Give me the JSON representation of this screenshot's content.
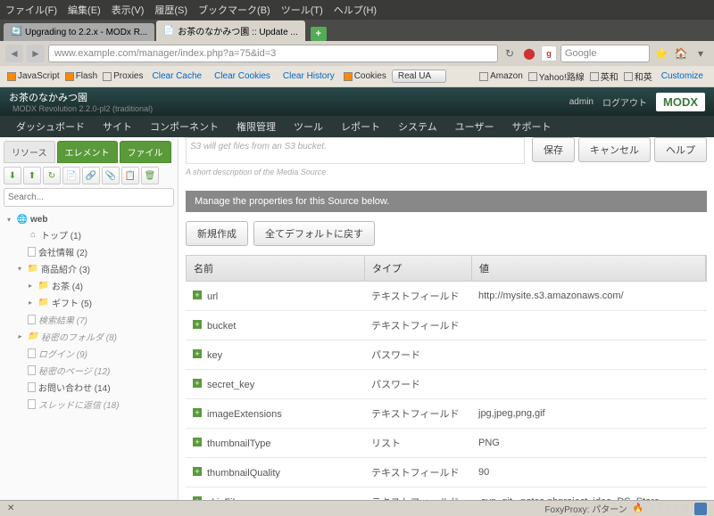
{
  "browser": {
    "menus": [
      "ファイル(F)",
      "編集(E)",
      "表示(V)",
      "履歴(S)",
      "ブックマーク(B)",
      "ツール(T)",
      "ヘルプ(H)"
    ],
    "tabs": [
      {
        "title": "Upgrading to 2.2.x - MODx R...",
        "active": false
      },
      {
        "title": "お茶のなかみつ園 :: Update ...",
        "active": true
      }
    ],
    "url": "www.example.com/manager/index.php?a=75&id=3",
    "search_placeholder": "Google"
  },
  "devbar": {
    "items": [
      "JavaScript",
      "Flash",
      "Proxies"
    ],
    "links": [
      "Clear Cache",
      "Clear Cookies",
      "Clear History"
    ],
    "cookies": "Cookies",
    "ua": "Real UA",
    "right_items": [
      "Amazon",
      "Yahoo!路線",
      "英和",
      "和英"
    ],
    "customize": "Customize"
  },
  "modx": {
    "site_title": "お茶のなかみつ園",
    "version": "MODX Revolution 2.2.0-pl2 (traditional)",
    "admin": "admin",
    "logout": "ログアウト",
    "logo": "MODX",
    "nav": [
      "ダッシュボード",
      "サイト",
      "コンポーネント",
      "権限管理",
      "ツール",
      "レポート",
      "システム",
      "ユーザー",
      "サポート"
    ]
  },
  "sidebar": {
    "tabs": [
      "リソース",
      "エレメント",
      "ファイル"
    ],
    "search_placeholder": "Search...",
    "tree": {
      "root": "web",
      "items": [
        {
          "label": "トップ (1)",
          "indent": 1,
          "icon": "home"
        },
        {
          "label": "会社情報 (2)",
          "indent": 1,
          "icon": "page"
        },
        {
          "label": "商品紹介 (3)",
          "indent": 1,
          "icon": "folder",
          "expanded": true
        },
        {
          "label": "お茶 (4)",
          "indent": 2,
          "icon": "folder"
        },
        {
          "label": "ギフト (5)",
          "indent": 2,
          "icon": "folder"
        },
        {
          "label": "検索結果 (7)",
          "indent": 1,
          "icon": "page",
          "italic": true
        },
        {
          "label": "秘密のフォルダ (8)",
          "indent": 1,
          "icon": "folder",
          "italic": true
        },
        {
          "label": "ログイン (9)",
          "indent": 1,
          "icon": "page",
          "italic": true
        },
        {
          "label": "秘密のページ (12)",
          "indent": 1,
          "icon": "page",
          "italic": true
        },
        {
          "label": "お問い合わせ (14)",
          "indent": 1,
          "icon": "page"
        },
        {
          "label": "スレッドに返信 (18)",
          "indent": 1,
          "icon": "page",
          "italic": true
        }
      ]
    }
  },
  "main": {
    "desc_text": "S3 will get files from an S3 bucket.",
    "buttons": {
      "save": "保存",
      "cancel": "キャンセル",
      "help": "ヘルプ"
    },
    "hint": "A short description of the Media Source.",
    "section_title": "Manage the properties for this Source below.",
    "sub_buttons": {
      "create": "新規作成",
      "reset": "全てデフォルトに戻す"
    },
    "columns": {
      "name": "名前",
      "type": "タイプ",
      "value": "値"
    },
    "rows": [
      {
        "name": "url",
        "type": "テキストフィールド",
        "value": "http://mysite.s3.amazonaws.com/"
      },
      {
        "name": "bucket",
        "type": "テキストフィールド",
        "value": ""
      },
      {
        "name": "key",
        "type": "パスワード",
        "value": ""
      },
      {
        "name": "secret_key",
        "type": "パスワード",
        "value": ""
      },
      {
        "name": "imageExtensions",
        "type": "テキストフィールド",
        "value": "jpg,jpeg,png,gif"
      },
      {
        "name": "thumbnailType",
        "type": "リスト",
        "value": "PNG"
      },
      {
        "name": "thumbnailQuality",
        "type": "テキストフィールド",
        "value": "90"
      },
      {
        "name": "skipFiles",
        "type": "テキストフィールド",
        "value": ".svn,.git,_notes,nbproject,.idea,.DS_Store"
      }
    ]
  },
  "statusbar": {
    "foxy": "FoxyProxy: パターン"
  }
}
